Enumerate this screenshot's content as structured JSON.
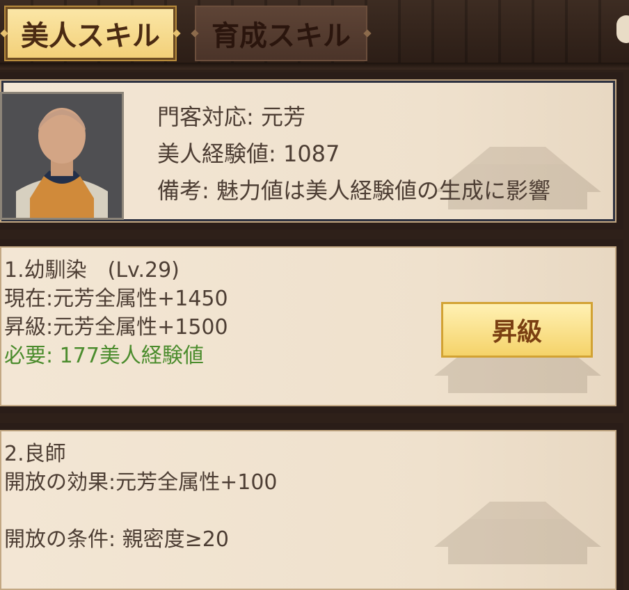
{
  "tabs": [
    {
      "label": "美人スキル",
      "active": true
    },
    {
      "label": "育成スキル",
      "active": false
    }
  ],
  "info": {
    "line1": "門客対応: 元芳",
    "line2": "美人経験値: 1087",
    "line3": "備考: 魅力値は美人経験値の生成に影響"
  },
  "skill1": {
    "title": "1.幼馴染　(Lv.29)",
    "current": "現在:元芳全属性+1450",
    "next": "昇級:元芳全属性+1500",
    "requirement": "必要: 177美人経験値",
    "button_label": "昇級"
  },
  "skill2": {
    "title": "2.良師",
    "effect": "開放の効果:元芳全属性+100",
    "condition": "開放の条件: 親密度≥20"
  },
  "colors": {
    "accent_gold": "#f2cf77",
    "requirement_green": "#4b8c2d",
    "text_brown": "#4d3e34"
  }
}
